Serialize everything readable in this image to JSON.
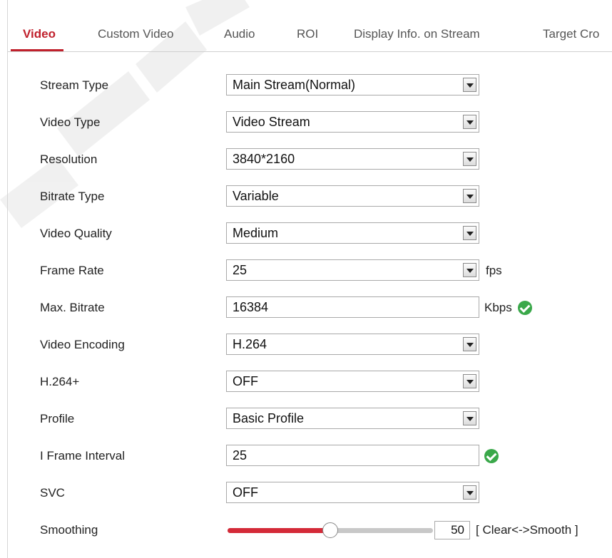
{
  "tabs": [
    {
      "label": "Video",
      "active": true
    },
    {
      "label": "Custom Video",
      "active": false
    },
    {
      "label": "Audio",
      "active": false
    },
    {
      "label": "ROI",
      "active": false
    },
    {
      "label": "Display Info. on Stream",
      "active": false
    },
    {
      "label": "Target Cro",
      "active": false
    }
  ],
  "fields": {
    "stream_type": {
      "label": "Stream Type",
      "value": "Main Stream(Normal)"
    },
    "video_type": {
      "label": "Video Type",
      "value": "Video Stream"
    },
    "resolution": {
      "label": "Resolution",
      "value": "3840*2160"
    },
    "bitrate_type": {
      "label": "Bitrate Type",
      "value": "Variable"
    },
    "video_quality": {
      "label": "Video Quality",
      "value": "Medium"
    },
    "frame_rate": {
      "label": "Frame Rate",
      "value": "25",
      "unit": "fps"
    },
    "max_bitrate": {
      "label": "Max. Bitrate",
      "value": "16384",
      "unit": "Kbps"
    },
    "video_encoding": {
      "label": "Video Encoding",
      "value": "H.264"
    },
    "h264_plus": {
      "label": "H.264+",
      "value": "OFF"
    },
    "profile": {
      "label": "Profile",
      "value": "Basic Profile"
    },
    "i_frame_interval": {
      "label": "I Frame Interval",
      "value": "25"
    },
    "svc": {
      "label": "SVC",
      "value": "OFF"
    },
    "smoothing": {
      "label": "Smoothing",
      "value": "50",
      "range_label": "[ Clear<->Smooth ]",
      "level_fraction": 0.5
    }
  },
  "icons": {
    "valid_check": "check-circle-icon"
  },
  "colors": {
    "accent": "#c0202c",
    "slider_fill": "#d42a38",
    "check": "#3aa84a"
  }
}
